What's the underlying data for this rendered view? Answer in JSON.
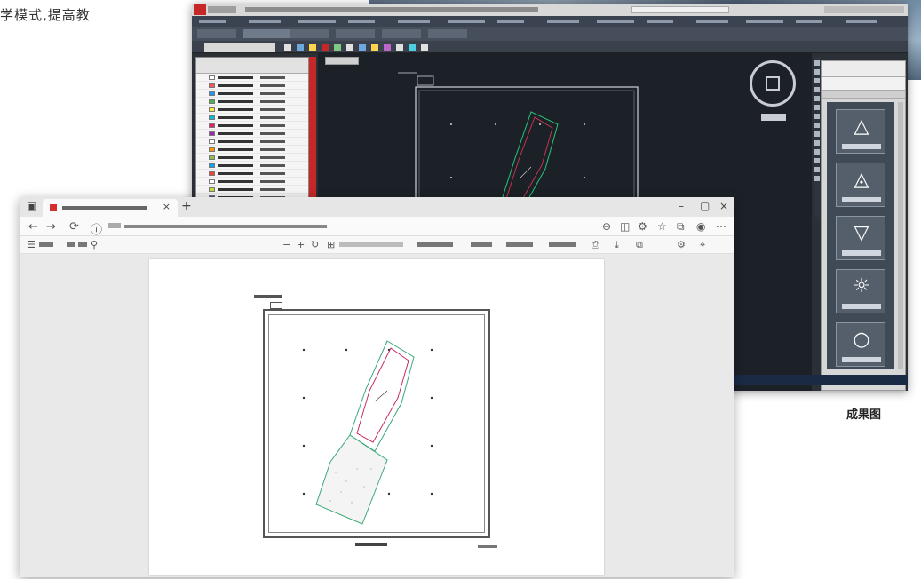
{
  "intro": {
    "text": "学模式,提高教"
  },
  "caption": {
    "text": "成果图"
  },
  "cad": {
    "menu_items": 14,
    "ribbon_tabs": 6,
    "tool_icons": [
      "#e0e0e0",
      "#6fa8dc",
      "#ffd54f",
      "#c62828",
      "#81c784",
      "#e0e0e0",
      "#6fa8dc",
      "#ffd54f",
      "#ba68c8",
      "#e0e0e0",
      "#4dd0e1",
      "#e0e0e0"
    ],
    "layer_swatches": [
      "#ffffff",
      "#ff5252",
      "#2196f3",
      "#4caf50",
      "#ffeb3b",
      "#00bcd4",
      "#e91e63",
      "#9c27b0",
      "#ffffff",
      "#ff9800",
      "#8bc34a",
      "#03a9f4",
      "#f44336",
      "#ffffff",
      "#cddc39",
      "#3f51b5",
      "#009688",
      "#ff5722",
      "#673ab7",
      "#ffc107",
      "#795548",
      "#607d8b"
    ],
    "symbol_tiles": [
      "△",
      "◬",
      "▽",
      "☼",
      "○"
    ]
  },
  "colors": {
    "cad_background": "#1c2128",
    "cad_drawing_green": "#27c27a",
    "cad_drawing_red": "#e53950",
    "pdf_drawing": "#333333",
    "pdf_green": "#3aa876",
    "pdf_magenta": "#c2185b"
  }
}
